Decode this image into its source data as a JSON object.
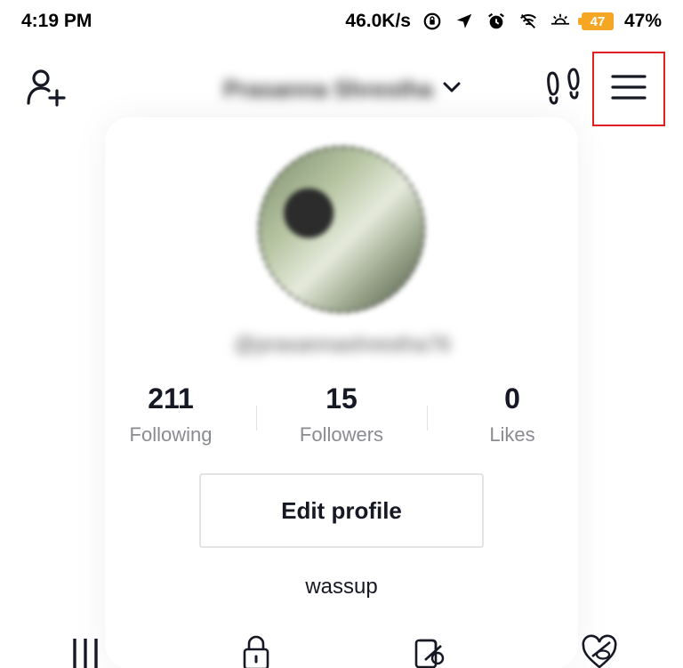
{
  "status_bar": {
    "time": "4:19 PM",
    "network_speed": "46.0K/s",
    "battery_level": "47",
    "battery_percent": "47%",
    "battery_color": "#f5a623",
    "icons": [
      "rotation-lock-icon",
      "location-arrow-icon",
      "alarm-icon",
      "wifi-icon",
      "brightness-icon"
    ]
  },
  "header": {
    "profile_name": "Prasanna Shrestha",
    "add_user_icon": "person-add-icon",
    "dropdown_icon": "chevron-down-icon",
    "footprint_icon": "footprints-icon",
    "menu_icon": "hamburger-menu-icon",
    "highlight_color": "#e02020"
  },
  "profile": {
    "username": "@prasannashrestha76",
    "bio": "wassup"
  },
  "stats": [
    {
      "value": "211",
      "label": "Following"
    },
    {
      "value": "15",
      "label": "Followers"
    },
    {
      "value": "0",
      "label": "Likes"
    }
  ],
  "edit_profile_label": "Edit profile",
  "tabs": [
    {
      "icon": "grid-icon"
    },
    {
      "icon": "lock-icon"
    },
    {
      "icon": "repost-icon"
    },
    {
      "icon": "liked-hidden-icon"
    }
  ]
}
